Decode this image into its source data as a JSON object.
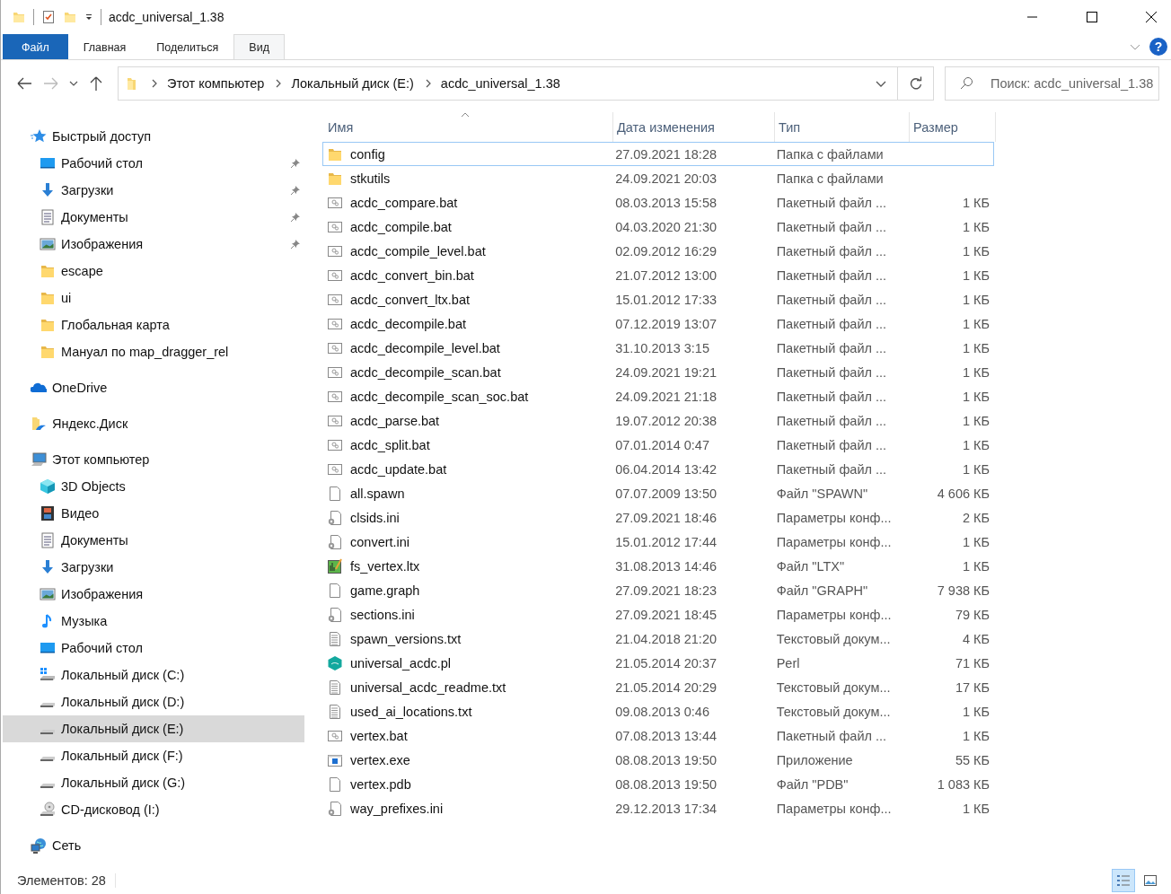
{
  "window": {
    "title": "acdc_universal_1.38"
  },
  "ribbon": {
    "help": "?",
    "tabs": [
      {
        "label": "Файл",
        "kind": "file",
        "selected": false
      },
      {
        "label": "Главная",
        "kind": "tab",
        "selected": false
      },
      {
        "label": "Поделиться",
        "kind": "tab",
        "selected": false
      },
      {
        "label": "Вид",
        "kind": "tab",
        "selected": true
      }
    ]
  },
  "address": {
    "segments": [
      "Этот компьютер",
      "Локальный диск (E:)",
      "acdc_universal_1.38"
    ]
  },
  "search": {
    "placeholder": "Поиск: acdc_universal_1.38"
  },
  "sidebar": {
    "items": [
      {
        "label": "Быстрый доступ",
        "selected": false,
        "children": [
          {
            "label": "Рабочий стол",
            "pinned": true,
            "selected": false
          },
          {
            "label": "Загрузки",
            "pinned": true,
            "selected": false
          },
          {
            "label": "Документы",
            "pinned": true,
            "selected": false
          },
          {
            "label": "Изображения",
            "pinned": true,
            "selected": false
          },
          {
            "label": "escape",
            "pinned": false,
            "selected": false
          },
          {
            "label": "ui",
            "pinned": false,
            "selected": false
          },
          {
            "label": "Глобальная карта",
            "pinned": false,
            "selected": false
          },
          {
            "label": "Мануал по map_dragger_rel",
            "pinned": false,
            "selected": false
          }
        ]
      },
      {
        "label": "OneDrive",
        "selected": false
      },
      {
        "label": "Яндекс.Диск",
        "selected": false
      },
      {
        "label": "Этот компьютер",
        "selected": false,
        "children": [
          {
            "label": "3D Objects",
            "selected": false
          },
          {
            "label": "Видео",
            "selected": false
          },
          {
            "label": "Документы",
            "selected": false
          },
          {
            "label": "Загрузки",
            "selected": false
          },
          {
            "label": "Изображения",
            "selected": false
          },
          {
            "label": "Музыка",
            "selected": false
          },
          {
            "label": "Рабочий стол",
            "selected": false
          },
          {
            "label": "Локальный диск (C:)",
            "selected": false
          },
          {
            "label": "Локальный диск (D:)",
            "selected": false
          },
          {
            "label": "Локальный диск (E:)",
            "selected": true
          },
          {
            "label": "Локальный диск (F:)",
            "selected": false
          },
          {
            "label": "Локальный диск (G:)",
            "selected": false
          },
          {
            "label": "CD-дисковод (I:)",
            "selected": false
          }
        ]
      },
      {
        "label": "Сеть",
        "selected": false
      }
    ]
  },
  "table": {
    "columns": [
      {
        "label": "Имя",
        "sorted": true
      },
      {
        "label": "Дата изменения",
        "sorted": false
      },
      {
        "label": "Тип",
        "sorted": false
      },
      {
        "label": "Размер",
        "sorted": false
      }
    ],
    "rows": [
      {
        "name": "config",
        "date": "27.09.2021 18:28",
        "type": "Папка с файлами",
        "size": "",
        "kind": "folder",
        "focused": true
      },
      {
        "name": "stkutils",
        "date": "24.09.2021 20:03",
        "type": "Папка с файлами",
        "size": "",
        "kind": "folder",
        "focused": false
      },
      {
        "name": "acdc_compare.bat",
        "date": "08.03.2013 15:58",
        "type": "Пакетный файл ...",
        "size": "1 КБ",
        "kind": "bat",
        "focused": false
      },
      {
        "name": "acdc_compile.bat",
        "date": "04.03.2020 21:30",
        "type": "Пакетный файл ...",
        "size": "1 КБ",
        "kind": "bat",
        "focused": false
      },
      {
        "name": "acdc_compile_level.bat",
        "date": "02.09.2012 16:29",
        "type": "Пакетный файл ...",
        "size": "1 КБ",
        "kind": "bat",
        "focused": false
      },
      {
        "name": "acdc_convert_bin.bat",
        "date": "21.07.2012 13:00",
        "type": "Пакетный файл ...",
        "size": "1 КБ",
        "kind": "bat",
        "focused": false
      },
      {
        "name": "acdc_convert_ltx.bat",
        "date": "15.01.2012 17:33",
        "type": "Пакетный файл ...",
        "size": "1 КБ",
        "kind": "bat",
        "focused": false
      },
      {
        "name": "acdc_decompile.bat",
        "date": "07.12.2019 13:07",
        "type": "Пакетный файл ...",
        "size": "1 КБ",
        "kind": "bat",
        "focused": false
      },
      {
        "name": "acdc_decompile_level.bat",
        "date": "31.10.2013 3:15",
        "type": "Пакетный файл ...",
        "size": "1 КБ",
        "kind": "bat",
        "focused": false
      },
      {
        "name": "acdc_decompile_scan.bat",
        "date": "24.09.2021 19:21",
        "type": "Пакетный файл ...",
        "size": "1 КБ",
        "kind": "bat",
        "focused": false
      },
      {
        "name": "acdc_decompile_scan_soc.bat",
        "date": "24.09.2021 21:18",
        "type": "Пакетный файл ...",
        "size": "1 КБ",
        "kind": "bat",
        "focused": false
      },
      {
        "name": "acdc_parse.bat",
        "date": "19.07.2012 20:38",
        "type": "Пакетный файл ...",
        "size": "1 КБ",
        "kind": "bat",
        "focused": false
      },
      {
        "name": "acdc_split.bat",
        "date": "07.01.2014 0:47",
        "type": "Пакетный файл ...",
        "size": "1 КБ",
        "kind": "bat",
        "focused": false
      },
      {
        "name": "acdc_update.bat",
        "date": "06.04.2014 13:42",
        "type": "Пакетный файл ...",
        "size": "1 КБ",
        "kind": "bat",
        "focused": false
      },
      {
        "name": "all.spawn",
        "date": "07.07.2009 13:50",
        "type": "Файл \"SPAWN\"",
        "size": "4 606 КБ",
        "kind": "file",
        "focused": false
      },
      {
        "name": "clsids.ini",
        "date": "27.09.2021 18:46",
        "type": "Параметры конф...",
        "size": "2 КБ",
        "kind": "ini",
        "focused": false
      },
      {
        "name": "convert.ini",
        "date": "15.01.2012 17:44",
        "type": "Параметры конф...",
        "size": "1 КБ",
        "kind": "ini",
        "focused": false
      },
      {
        "name": "fs_vertex.ltx",
        "date": "31.08.2013 14:46",
        "type": "Файл \"LTX\"",
        "size": "1 КБ",
        "kind": "ltx",
        "focused": false
      },
      {
        "name": "game.graph",
        "date": "27.09.2021 18:23",
        "type": "Файл \"GRAPH\"",
        "size": "7 938 КБ",
        "kind": "file",
        "focused": false
      },
      {
        "name": "sections.ini",
        "date": "27.09.2021 18:45",
        "type": "Параметры конф...",
        "size": "79 КБ",
        "kind": "ini",
        "focused": false
      },
      {
        "name": "spawn_versions.txt",
        "date": "21.04.2018 21:20",
        "type": "Текстовый докум...",
        "size": "4 КБ",
        "kind": "txt",
        "focused": false
      },
      {
        "name": "universal_acdc.pl",
        "date": "21.05.2014 20:37",
        "type": "Perl",
        "size": "71 КБ",
        "kind": "perl",
        "focused": false
      },
      {
        "name": "universal_acdc_readme.txt",
        "date": "21.05.2014 20:29",
        "type": "Текстовый докум...",
        "size": "17 КБ",
        "kind": "txt",
        "focused": false
      },
      {
        "name": "used_ai_locations.txt",
        "date": "09.08.2013 0:46",
        "type": "Текстовый докум...",
        "size": "1 КБ",
        "kind": "txt",
        "focused": false
      },
      {
        "name": "vertex.bat",
        "date": "07.08.2013 13:44",
        "type": "Пакетный файл ...",
        "size": "1 КБ",
        "kind": "bat",
        "focused": false
      },
      {
        "name": "vertex.exe",
        "date": "08.08.2013 19:50",
        "type": "Приложение",
        "size": "55 КБ",
        "kind": "exe",
        "focused": false
      },
      {
        "name": "vertex.pdb",
        "date": "08.08.2013 19:50",
        "type": "Файл \"PDB\"",
        "size": "1 083 КБ",
        "kind": "file",
        "focused": false
      },
      {
        "name": "way_prefixes.ini",
        "date": "29.12.2013 17:34",
        "type": "Параметры конф...",
        "size": "1 КБ",
        "kind": "ini",
        "focused": false
      }
    ]
  },
  "status_bar": {
    "count": "Элементов: 28",
    "views": [
      {
        "kind": "details",
        "selected": true
      },
      {
        "kind": "tiles",
        "selected": false
      }
    ]
  }
}
